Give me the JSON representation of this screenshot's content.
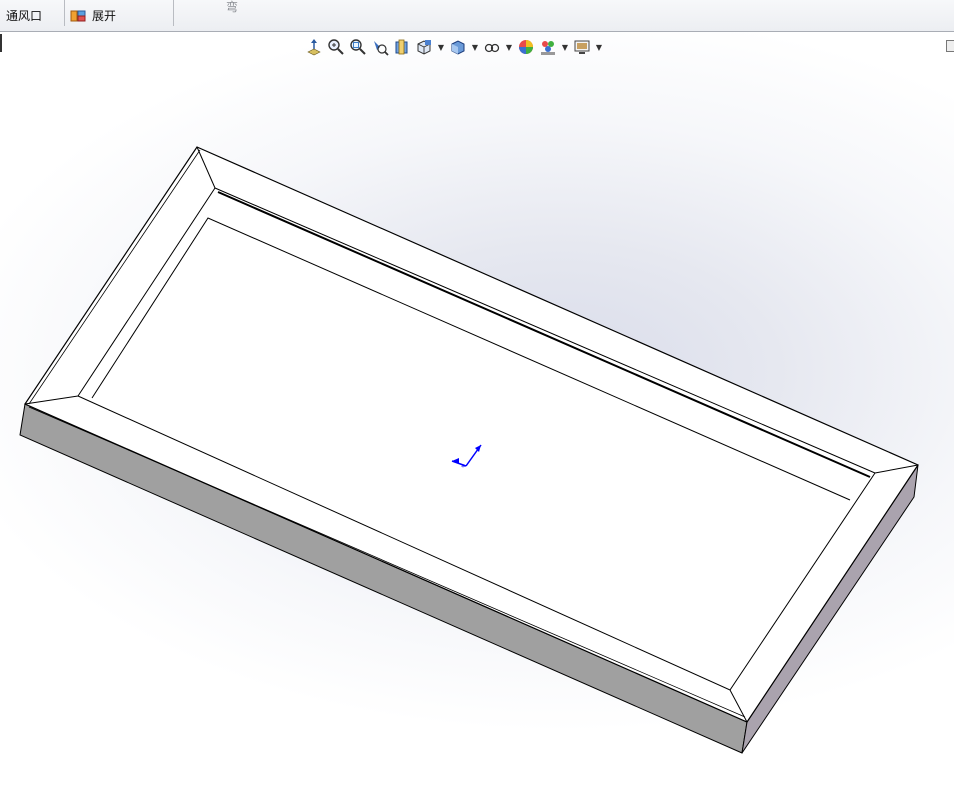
{
  "ribbon": {
    "vent_label": "通风口",
    "unfold_label": "展开",
    "bend_label": "弯"
  },
  "view_toolbar": {
    "buttons": [
      "view-orientation-icon",
      "zoom-to-fit-icon",
      "zoom-to-area-icon",
      "previous-view-icon",
      "section-view-icon",
      "view-orientation-cube-icon",
      "display-style-icon",
      "hide-show-items-icon",
      "edit-appearance-icon",
      "apply-scene-icon",
      "view-settings-icon"
    ]
  },
  "colors": {
    "model_face": "#ffffff",
    "model_side": "#a0a0a0",
    "model_edge": "#000000",
    "triad": "#0000ff"
  }
}
